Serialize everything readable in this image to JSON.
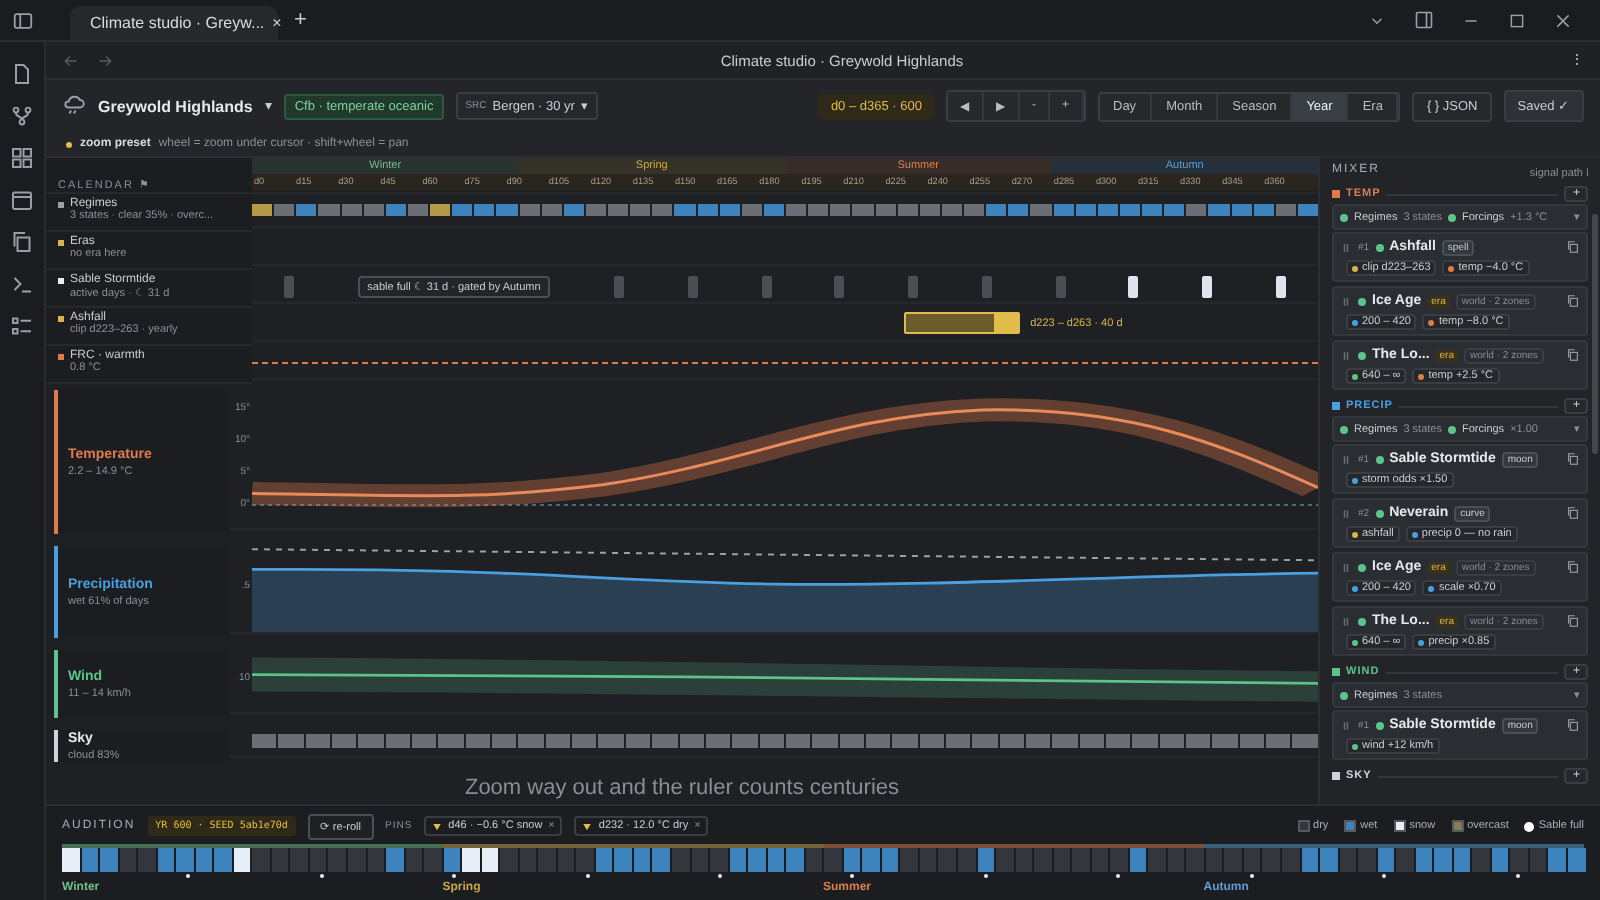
{
  "browser": {
    "tab_title": "Climate studio · Greyw...",
    "tab_close": "×",
    "new_tab": "+",
    "address_title": "Climate studio · Greywold Highlands",
    "menu": "⋮"
  },
  "header": {
    "title": "Greywold Highlands",
    "caret": "▾",
    "climate_badge": "Cfb · temperate oceanic",
    "source_label": "SRC",
    "source": "Bergen · 30 yr",
    "source_caret": "▾",
    "range": "d0 – d365 · 600",
    "nav": [
      "◀",
      "▶",
      "-",
      "+"
    ],
    "zoom_levels": [
      {
        "label": "Day",
        "selected": false
      },
      {
        "label": "Month",
        "selected": false
      },
      {
        "label": "Season",
        "selected": false
      },
      {
        "label": "Year",
        "selected": true
      },
      {
        "label": "Era",
        "selected": false
      }
    ],
    "json_button": "{ } JSON",
    "saved": "Saved ✓"
  },
  "hint": {
    "preset": "zoom preset",
    "text": "wheel = zoom under cursor · shift+wheel = pan"
  },
  "calendar": {
    "title": "CALENDAR ⚑",
    "seasons": [
      {
        "label": "Winter",
        "color": "#6fbf8a"
      },
      {
        "label": "Spring",
        "color": "#c9a94a"
      },
      {
        "label": "Summer",
        "color": "#d9804a"
      },
      {
        "label": "Autumn",
        "color": "#5a9fd6"
      }
    ],
    "ticks": [
      "d0",
      "d15",
      "d30",
      "d45",
      "d60",
      "d75",
      "d90",
      "d105",
      "d120",
      "d135",
      "d150",
      "d165",
      "d180",
      "d195",
      "d210",
      "d225",
      "d240",
      "d255",
      "d270",
      "d285",
      "d300",
      "d315",
      "d330",
      "d345",
      "d360"
    ]
  },
  "tracks": [
    {
      "kind": "regimes",
      "name": "Regimes",
      "detail": "3 states · clear 35% · overc...",
      "color": "#9aa0a6",
      "cells": [
        {
          "color": "#b59a45"
        },
        {
          "color": "#6b6f75"
        },
        {
          "color": "#3d84bf"
        },
        {
          "color": "#6b6f75"
        },
        {
          "color": "#6b6f75"
        },
        {
          "color": "#6b6f75"
        },
        {
          "color": "#3d84bf"
        },
        {
          "color": "#6b6f75"
        },
        {
          "color": "#b59a45"
        },
        {
          "color": "#3d84bf"
        },
        {
          "color": "#3d84bf"
        },
        {
          "color": "#3d84bf"
        },
        {
          "color": "#6b6f75"
        },
        {
          "color": "#6b6f75"
        },
        {
          "color": "#3d84bf"
        },
        {
          "color": "#6b6f75"
        },
        {
          "color": "#6b6f75"
        },
        {
          "color": "#6b6f75"
        },
        {
          "color": "#6b6f75"
        },
        {
          "color": "#3d84bf"
        },
        {
          "color": "#3d84bf"
        },
        {
          "color": "#3d84bf"
        },
        {
          "color": "#6b6f75"
        },
        {
          "color": "#3d84bf"
        },
        {
          "color": "#6b6f75"
        },
        {
          "color": "#6b6f75"
        },
        {
          "color": "#6b6f75"
        },
        {
          "color": "#6b6f75"
        },
        {
          "color": "#6b6f75"
        },
        {
          "color": "#6b6f75"
        },
        {
          "color": "#6b6f75"
        },
        {
          "color": "#6b6f75"
        },
        {
          "color": "#6b6f75"
        },
        {
          "color": "#3d84bf"
        },
        {
          "color": "#3d84bf"
        },
        {
          "color": "#6b6f75"
        },
        {
          "color": "#3d84bf"
        },
        {
          "color": "#3d84bf"
        },
        {
          "color": "#3d84bf"
        },
        {
          "color": "#3d84bf"
        },
        {
          "color": "#3d84bf"
        },
        {
          "color": "#3d84bf"
        },
        {
          "color": "#6b6f75"
        },
        {
          "color": "#3d84bf"
        },
        {
          "color": "#3d84bf"
        },
        {
          "color": "#3d84bf"
        },
        {
          "color": "#6b6f75"
        },
        {
          "color": "#3d84bf"
        }
      ]
    },
    {
      "kind": "eras",
      "name": "Eras",
      "detail": "no era here",
      "color": "#d9b44a"
    },
    {
      "kind": "moon",
      "name": "Sable Stormtide",
      "detail": "active days · ☾ 31 d",
      "color": "#e8eef5",
      "tooltip": "sable full ☾ 31 d · gated by Autumn",
      "marks": [
        {
          "full": false
        },
        {
          "full": false
        },
        {
          "full": false
        },
        {
          "full": false
        },
        {
          "full": false
        },
        {
          "full": false
        },
        {
          "full": false
        },
        {
          "full": false
        },
        {
          "full": true
        },
        {
          "full": true
        },
        {
          "full": true
        }
      ]
    },
    {
      "kind": "clip",
      "name": "Ashfall",
      "detail": "clip d223–263 · yearly",
      "color": "#d9b44a",
      "clip_label": "d223 – d263 · 40 d"
    },
    {
      "kind": "line",
      "name": "FRC · warmth",
      "detail": "0.8 °C",
      "color": "#e07a4a"
    }
  ],
  "lanes": [
    {
      "kind": "temperature",
      "name": "Temperature",
      "detail": "2.2 – 14.9 °C",
      "color": "#e07a4a",
      "ticks": [
        "15°",
        "10°",
        "5°",
        "0°"
      ]
    },
    {
      "kind": "precipitation",
      "name": "Precipitation",
      "detail": "wet 61% of days",
      "color": "#4a9fe0",
      "ticks": [
        ".5"
      ]
    },
    {
      "kind": "wind",
      "name": "Wind",
      "detail": "11 – 14 km/h",
      "color": "#5cc48a",
      "ticks": [
        "10"
      ]
    },
    {
      "kind": "sky",
      "name": "Sky",
      "detail": "cloud 83%",
      "color": "#d0d4da"
    }
  ],
  "caption": "Zoom way out and the ruler counts centuries",
  "mixer": {
    "title": "MIXER",
    "signal_path": "signal path ℹ",
    "sections": [
      {
        "name": "TEMP",
        "color": "#e07a4a",
        "add": "+",
        "regimes": {
          "label": "Regimes",
          "states": "3 states",
          "on": true,
          "forcings": "Forcings",
          "forcings_on": true,
          "forcing_value": "+1.3 °C",
          "caret": "▾"
        },
        "cards": [
          {
            "kind": "effect",
            "index": "#1",
            "name": "Ashfall",
            "enabled": true,
            "tag": "spell",
            "params": [
              {
                "color": "#d9b44a",
                "text": "clip d223–263"
              },
              {
                "color": "#e07a4a",
                "text": "temp −4.0 °C"
              }
            ]
          },
          {
            "kind": "era",
            "name": "Ice Age",
            "enabled": true,
            "tag": "era",
            "scope": "world · 2 zones",
            "params": [
              {
                "color": "#4a9fe0",
                "text": "200 – 420"
              },
              {
                "color": "#e07a4a",
                "text": "temp −8.0 °C"
              }
            ]
          },
          {
            "kind": "era",
            "name": "The Lo...",
            "enabled": true,
            "tag": "era",
            "scope": "world · 2 zones",
            "params": [
              {
                "color": "#5cc48a",
                "text": "640 – ∞"
              },
              {
                "color": "#e07a4a",
                "text": "temp +2.5 °C"
              }
            ]
          }
        ]
      },
      {
        "name": "PRECIP",
        "color": "#4a9fe0",
        "add": "+",
        "regimes": {
          "label": "Regimes",
          "states": "3 states",
          "on": true,
          "forcings": "Forcings",
          "forcings_on": true,
          "forcing_value": "×1.00",
          "caret": "▾"
        },
        "cards": [
          {
            "kind": "effect",
            "index": "#1",
            "name": "Sable Stormtide",
            "enabled": true,
            "tag": "moon",
            "params": [
              {
                "color": "#4a9fe0",
                "text": "storm odds ×1.50"
              }
            ]
          },
          {
            "kind": "effect",
            "index": "#2",
            "name": "Neverain",
            "enabled": true,
            "tag": "curve",
            "params": [
              {
                "color": "#d9b44a",
                "text": "ashfall"
              },
              {
                "color": "#4a9fe0",
                "text": "precip 0 — no rain"
              }
            ]
          },
          {
            "kind": "era",
            "name": "Ice Age",
            "enabled": true,
            "tag": "era",
            "scope": "world · 2 zones",
            "params": [
              {
                "color": "#4a9fe0",
                "text": "200 – 420"
              },
              {
                "color": "#4a9fe0",
                "text": "scale ×0.70"
              }
            ]
          },
          {
            "kind": "era",
            "name": "The Lo...",
            "enabled": true,
            "tag": "era",
            "scope": "world · 2 zones",
            "params": [
              {
                "color": "#5cc48a",
                "text": "640 – ∞"
              },
              {
                "color": "#4a9fe0",
                "text": "precip ×0.85"
              }
            ]
          }
        ]
      },
      {
        "name": "WIND",
        "color": "#5cc48a",
        "add": "+",
        "regimes": {
          "label": "Regimes",
          "states": "3 states",
          "on": true,
          "caret": "▾"
        },
        "cards": [
          {
            "kind": "effect",
            "index": "#1",
            "name": "Sable Stormtide",
            "enabled": true,
            "tag": "moon",
            "params": [
              {
                "color": "#5cc48a",
                "text": "wind +12 km/h"
              }
            ]
          }
        ]
      },
      {
        "name": "SKY",
        "color": "#d0d4da",
        "add": "+"
      }
    ]
  },
  "audition": {
    "title": "AUDITION",
    "seed": "YR 600 · SEED 5ab1e70d",
    "reroll": "⟳ re-roll",
    "pins_label": "PINS",
    "pins": [
      {
        "text": "d46 · −0.6 °C snow",
        "close": "×"
      },
      {
        "text": "d232 · 12.0 °C dry",
        "close": "×"
      }
    ],
    "legend": [
      {
        "label": "dry",
        "color": "#33373d"
      },
      {
        "label": "wet",
        "color": "#3d84bf"
      },
      {
        "label": "snow",
        "color": "#e8eef5"
      },
      {
        "label": "overcast",
        "color": "#8a7a55"
      },
      {
        "label": "Sable full",
        "color": "#ffffff"
      }
    ],
    "strip": [
      {
        "kind": "snow"
      },
      {
        "kind": "wet"
      },
      {
        "kind": "wet"
      },
      {
        "kind": "dry"
      },
      {
        "kind": "dry"
      },
      {
        "kind": "wet"
      },
      {
        "kind": "wet"
      },
      {
        "kind": "wet"
      },
      {
        "kind": "wet"
      },
      {
        "kind": "snow"
      },
      {
        "kind": "dry"
      },
      {
        "kind": "dry"
      },
      {
        "kind": "dry"
      },
      {
        "kind": "dry"
      },
      {
        "kind": "dry"
      },
      {
        "kind": "dry"
      },
      {
        "kind": "dry"
      },
      {
        "kind": "wet"
      },
      {
        "kind": "dry"
      },
      {
        "kind": "dry"
      },
      {
        "kind": "wet"
      },
      {
        "kind": "snow"
      },
      {
        "kind": "snow"
      },
      {
        "kind": "dry"
      },
      {
        "kind": "dry"
      },
      {
        "kind": "dry"
      },
      {
        "kind": "dry"
      },
      {
        "kind": "dry"
      },
      {
        "kind": "wet"
      },
      {
        "kind": "wet"
      },
      {
        "kind": "wet"
      },
      {
        "kind": "wet"
      },
      {
        "kind": "dry"
      },
      {
        "kind": "dry"
      },
      {
        "kind": "dry"
      },
      {
        "kind": "wet"
      },
      {
        "kind": "wet"
      },
      {
        "kind": "wet"
      },
      {
        "kind": "wet"
      },
      {
        "kind": "dry"
      },
      {
        "kind": "dry"
      },
      {
        "kind": "wet"
      },
      {
        "kind": "wet"
      },
      {
        "kind": "wet"
      },
      {
        "kind": "dry"
      },
      {
        "kind": "dry"
      },
      {
        "kind": "dry"
      },
      {
        "kind": "dry"
      },
      {
        "kind": "wet"
      },
      {
        "kind": "dry"
      },
      {
        "kind": "dry"
      },
      {
        "kind": "dry"
      },
      {
        "kind": "dry"
      },
      {
        "kind": "dry"
      },
      {
        "kind": "dry"
      },
      {
        "kind": "dry"
      },
      {
        "kind": "wet"
      },
      {
        "kind": "dry"
      },
      {
        "kind": "dry"
      },
      {
        "kind": "dry"
      },
      {
        "kind": "dry"
      },
      {
        "kind": "dry"
      },
      {
        "kind": "dry"
      },
      {
        "kind": "dry"
      },
      {
        "kind": "dry"
      },
      {
        "kind": "wet"
      },
      {
        "kind": "wet"
      },
      {
        "kind": "dry"
      },
      {
        "kind": "dry"
      },
      {
        "kind": "wet"
      },
      {
        "kind": "dry"
      },
      {
        "kind": "wet"
      },
      {
        "kind": "wet"
      },
      {
        "kind": "wet"
      },
      {
        "kind": "dry"
      },
      {
        "kind": "wet"
      },
      {
        "kind": "dry"
      },
      {
        "kind": "dry"
      },
      {
        "kind": "wet"
      },
      {
        "kind": "wet"
      }
    ],
    "seasons": [
      {
        "label": "Winter",
        "color": "#6fbf8a"
      },
      {
        "label": "Spring",
        "color": "#c9a94a"
      },
      {
        "label": "Summer",
        "color": "#d9804a"
      },
      {
        "label": "Autumn",
        "color": "#5a9fd6"
      }
    ]
  }
}
